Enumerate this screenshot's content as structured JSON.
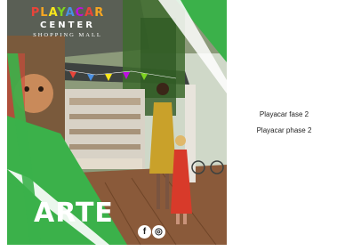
{
  "banner": {
    "logo": {
      "line1": "PLAYACAR",
      "line2": "CENTER",
      "line3": "SHOPPING MALL"
    },
    "headline": "ARTE",
    "social": [
      {
        "icon": "facebook-icon",
        "glyph": "f"
      },
      {
        "icon": "instagram-icon",
        "glyph": "◎"
      }
    ],
    "colors": {
      "brand_green": "#3bb14a",
      "logo_palette": [
        "#e8443a",
        "#f5a623",
        "#f8e71c",
        "#7ed321",
        "#4a90e2",
        "#bd10e0"
      ]
    }
  },
  "captions": [
    "Playacar fase 2",
    "Playacar phase 2"
  ]
}
